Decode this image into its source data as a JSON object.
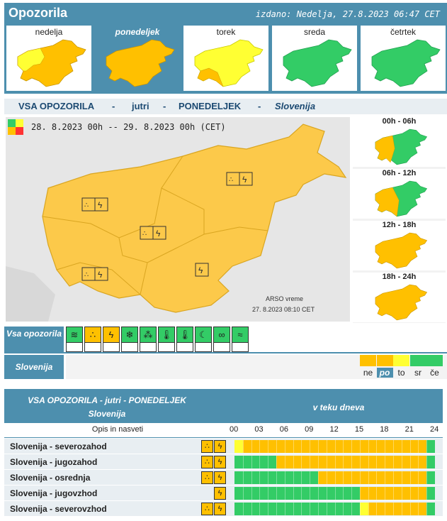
{
  "header": {
    "title": "Opozorila",
    "issued": "izdano: Nedelja, 27.8.2023 06:47 CET"
  },
  "colors": {
    "green": "#33cc66",
    "yellow": "#ffff33",
    "orange": "#ffc000",
    "red": "#ff3333",
    "accent": "#4d8fae"
  },
  "days": [
    {
      "name": "nedelja",
      "active": false,
      "level": "mixed-yellow-orange"
    },
    {
      "name": "ponedeljek",
      "active": true,
      "level": "orange"
    },
    {
      "name": "torek",
      "active": false,
      "level": "mixed-yellow-orange"
    },
    {
      "name": "sreda",
      "active": false,
      "level": "green"
    },
    {
      "name": "četrtek",
      "active": false,
      "level": "green"
    }
  ],
  "subhead": {
    "a": "VSA OPOZORILA",
    "b": "jutri",
    "c": "PONEDELJEK",
    "d": "Slovenija",
    "sep": "-"
  },
  "map": {
    "time_from": "28. 8.2023  00h",
    "sep": "--",
    "time_to": "29. 8.2023  00h",
    "tz": "(CET)",
    "credit": "ARSO vreme",
    "credit_time": "27. 8.2023  08:10 CET"
  },
  "periods": [
    {
      "label": "00h - 06h",
      "level": "orange-green"
    },
    {
      "label": "06h - 12h",
      "level": "orange-green"
    },
    {
      "label": "12h - 18h",
      "level": "orange"
    },
    {
      "label": "18h - 24h",
      "level": "orange"
    }
  ],
  "warning_types": {
    "label": "Vsa opozorila",
    "icons": [
      {
        "name": "wind-icon",
        "color": "green"
      },
      {
        "name": "rain-icon",
        "color": "orange"
      },
      {
        "name": "thunderstorm-icon",
        "color": "orange"
      },
      {
        "name": "snow-icon",
        "color": "green"
      },
      {
        "name": "ice-icon",
        "color": "green"
      },
      {
        "name": "high-temp-icon",
        "color": "green"
      },
      {
        "name": "low-temp-icon",
        "color": "green"
      },
      {
        "name": "fire-icon",
        "color": "green"
      },
      {
        "name": "coastal-icon",
        "color": "green"
      },
      {
        "name": "fog-icon",
        "color": "green"
      }
    ]
  },
  "region_row": {
    "label": "Slovenija",
    "days": [
      {
        "abbr": "ne",
        "color": "orange",
        "selected": false
      },
      {
        "abbr": "po",
        "color": "orange",
        "selected": true
      },
      {
        "abbr": "to",
        "color": "yellow",
        "selected": false
      },
      {
        "abbr": "sr",
        "color": "green",
        "selected": false
      },
      {
        "abbr": "če",
        "color": "green",
        "selected": false
      }
    ]
  },
  "table": {
    "title": "VSA OPOZORILA - jutri - PONEDELJEK",
    "region": "Slovenija",
    "during_day": "v teku dneva",
    "desc_header": "Opis in nasveti",
    "ticks": [
      "00",
      "03",
      "06",
      "09",
      "12",
      "15",
      "18",
      "21",
      "24"
    ],
    "rows": [
      {
        "name": "Slovenija - severozahod",
        "icons": [
          "rain-icon",
          "thunderstorm-icon"
        ],
        "segments": [
          {
            "from": 0,
            "to": 1,
            "color": "yellow"
          },
          {
            "from": 1,
            "to": 23,
            "color": "orange"
          },
          {
            "from": 23,
            "to": 24,
            "color": "green"
          }
        ]
      },
      {
        "name": "Slovenija - jugozahod",
        "icons": [
          "rain-icon",
          "thunderstorm-icon"
        ],
        "segments": [
          {
            "from": 0,
            "to": 5,
            "color": "green"
          },
          {
            "from": 5,
            "to": 23,
            "color": "orange"
          },
          {
            "from": 23,
            "to": 24,
            "color": "green"
          }
        ]
      },
      {
        "name": "Slovenija - osrednja",
        "icons": [
          "rain-icon",
          "thunderstorm-icon"
        ],
        "segments": [
          {
            "from": 0,
            "to": 10,
            "color": "green"
          },
          {
            "from": 10,
            "to": 23,
            "color": "orange"
          },
          {
            "from": 23,
            "to": 24,
            "color": "green"
          }
        ]
      },
      {
        "name": "Slovenija - jugovzhod",
        "icons": [
          "thunderstorm-icon"
        ],
        "segments": [
          {
            "from": 0,
            "to": 15,
            "color": "green"
          },
          {
            "from": 15,
            "to": 23,
            "color": "orange"
          },
          {
            "from": 23,
            "to": 24,
            "color": "green"
          }
        ]
      },
      {
        "name": "Slovenija - severovzhod",
        "icons": [
          "rain-icon",
          "thunderstorm-icon"
        ],
        "segments": [
          {
            "from": 0,
            "to": 15,
            "color": "green"
          },
          {
            "from": 15,
            "to": 16,
            "color": "yellow"
          },
          {
            "from": 16,
            "to": 23,
            "color": "orange"
          },
          {
            "from": 23,
            "to": 24,
            "color": "green"
          }
        ]
      }
    ]
  }
}
